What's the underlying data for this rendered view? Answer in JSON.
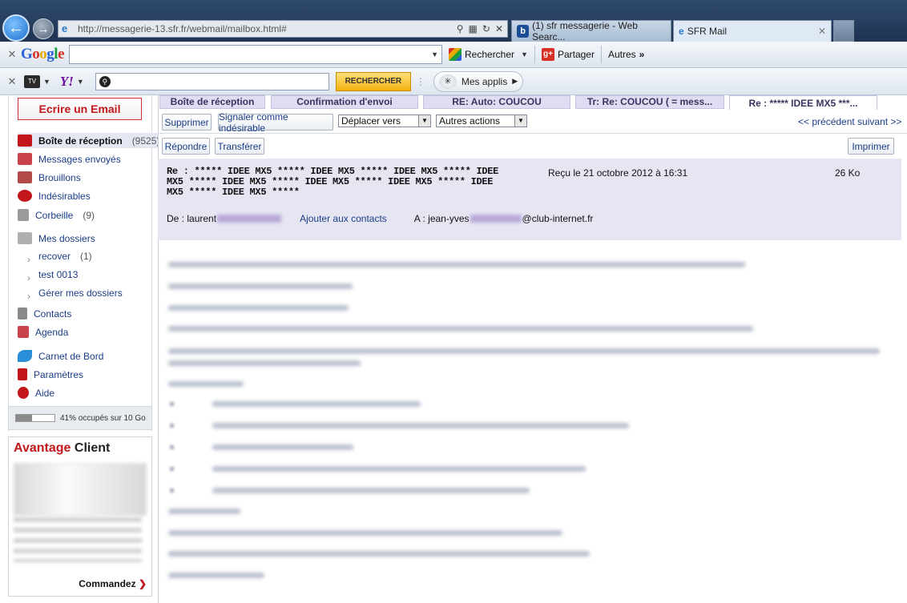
{
  "browser": {
    "address": "http://messagerie-13.sfr.fr/webmail/mailbox.html#",
    "address_domain_bold": "sfr.fr",
    "tabs": [
      {
        "label": "(1) sfr messagerie - Web Searc..."
      },
      {
        "label": "SFR Mail"
      }
    ]
  },
  "google_toolbar": {
    "logo": "Google",
    "search_value": "",
    "rechercher": "Rechercher",
    "partager": "Partager",
    "autres": "Autres"
  },
  "yahoo_toolbar": {
    "tv": "MSN TV",
    "logo": "Y!",
    "search_value": "",
    "rechercher": "RECHERCHER",
    "mes_applis": "Mes applis"
  },
  "sidebar": {
    "compose": "Ecrire un Email",
    "items": [
      {
        "label": "Boîte de réception",
        "count": "(9525)"
      },
      {
        "label": "Messages envoyés",
        "count": ""
      },
      {
        "label": "Brouillons",
        "count": ""
      },
      {
        "label": "Indésirables",
        "count": ""
      },
      {
        "label": "Corbeille",
        "count": "(9)"
      },
      {
        "label": "Mes dossiers",
        "count": ""
      },
      {
        "label": "recover",
        "count": "(1)"
      },
      {
        "label": "test 0013",
        "count": ""
      },
      {
        "label": "Gérer mes dossiers",
        "count": ""
      },
      {
        "label": "Contacts",
        "count": ""
      },
      {
        "label": "Agenda",
        "count": ""
      },
      {
        "label": "Carnet de Bord",
        "count": ""
      },
      {
        "label": "Paramètres",
        "count": ""
      },
      {
        "label": "Aide",
        "count": ""
      }
    ],
    "quota": {
      "text": "41% occupés sur 10 Go",
      "fraction": 0.41
    }
  },
  "advantage": {
    "title_red": "Avantage",
    "title_black": "Client",
    "cta": "Commandez",
    "cta_arrow": "❯"
  },
  "mail_tabs": [
    {
      "label": "Boîte de réception"
    },
    {
      "label": "Confirmation d'envoi"
    },
    {
      "label": "RE: Auto: COUCOU"
    },
    {
      "label": "Tr: Re: COUCOU ( = mess..."
    },
    {
      "label": "Re : ***** IDEE MX5 ***..."
    }
  ],
  "actions": {
    "supprimer": "Supprimer",
    "signaler": "Signaler comme indésirable",
    "deplacer": "Déplacer vers",
    "autres_actions": "Autres actions",
    "pagenav": "<< précédent suivant >>",
    "repondre": "Répondre",
    "transferer": "Transférer",
    "imprimer": "Imprimer"
  },
  "message": {
    "subject": "Re : ***** IDEE MX5 ***** IDEE MX5 ***** IDEE MX5 ***** IDEE MX5 ***** IDEE MX5 ***** IDEE MX5 ***** IDEE MX5 ***** IDEE MX5 ***** IDEE MX5 *****",
    "received": "Reçu le 21 octobre 2012 à 16:31",
    "size": "26 Ko",
    "from_label": "De :",
    "from_name": "laurent",
    "add_contact": "Ajouter aux contacts",
    "to_label": "A :",
    "to_name": "jean-yves",
    "to_domain": "@club-internet.fr"
  }
}
